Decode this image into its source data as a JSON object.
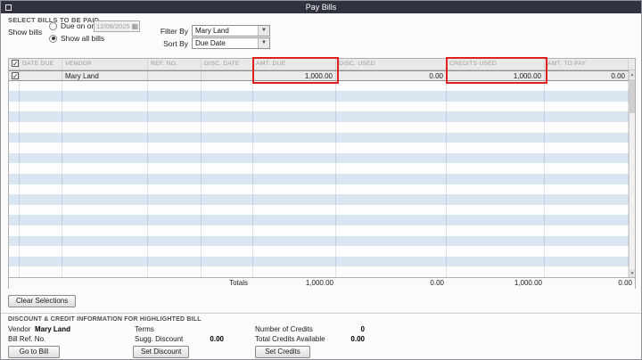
{
  "window": {
    "title": "Pay Bills"
  },
  "filters": {
    "section_label": "SELECT BILLS TO BE PAID",
    "show_bills_label": "Show bills",
    "radio_due_label": "Due on or before",
    "due_date_value": "12/08/2025",
    "radio_all_label": "Show all bills",
    "filter_by_label": "Filter By",
    "filter_by_value": "Mary Land",
    "sort_by_label": "Sort By",
    "sort_by_value": "Due Date"
  },
  "table": {
    "columns": [
      "DATE DUE",
      "VENDOR",
      "REF. NO.",
      "DISC. DATE",
      "AMT. DUE",
      "DISC. USED",
      "CREDITS USED",
      "AMT. TO PAY"
    ],
    "rows": [
      {
        "checked": true,
        "date_due": "",
        "vendor": "Mary Land",
        "ref_no": "",
        "disc_date": "",
        "amt_due": "1,000.00",
        "disc_used": "0.00",
        "credits_used": "1,000.00",
        "amt_to_pay": "0.00"
      }
    ],
    "empty_row_count": 19,
    "totals_label": "Totals",
    "totals": {
      "amt_due": "1,000.00",
      "disc_used": "0.00",
      "credits_used": "1,000.00",
      "amt_to_pay": "0.00"
    }
  },
  "actions": {
    "clear_selections": "Clear Selections"
  },
  "detail": {
    "section_label": "DISCOUNT & CREDIT INFORMATION FOR HIGHLIGHTED BILL",
    "vendor_label": "Vendor",
    "vendor_value": "Mary Land",
    "bill_ref_label": "Bill Ref. No.",
    "terms_label": "Terms",
    "sugg_discount_label": "Sugg. Discount",
    "sugg_discount_value": "0.00",
    "number_of_credits_label": "Number of Credits",
    "number_of_credits_value": "0",
    "total_credits_label": "Total Credits Available",
    "total_credits_value": "0.00",
    "go_to_bill_label": "Go to Bill",
    "set_discount_label": "Set Discount",
    "set_credits_label": "Set Credits"
  },
  "colors": {
    "highlight_red": "#e0201f",
    "titlebar": "#313240",
    "row_alt_blue": "#d9e6f2"
  }
}
